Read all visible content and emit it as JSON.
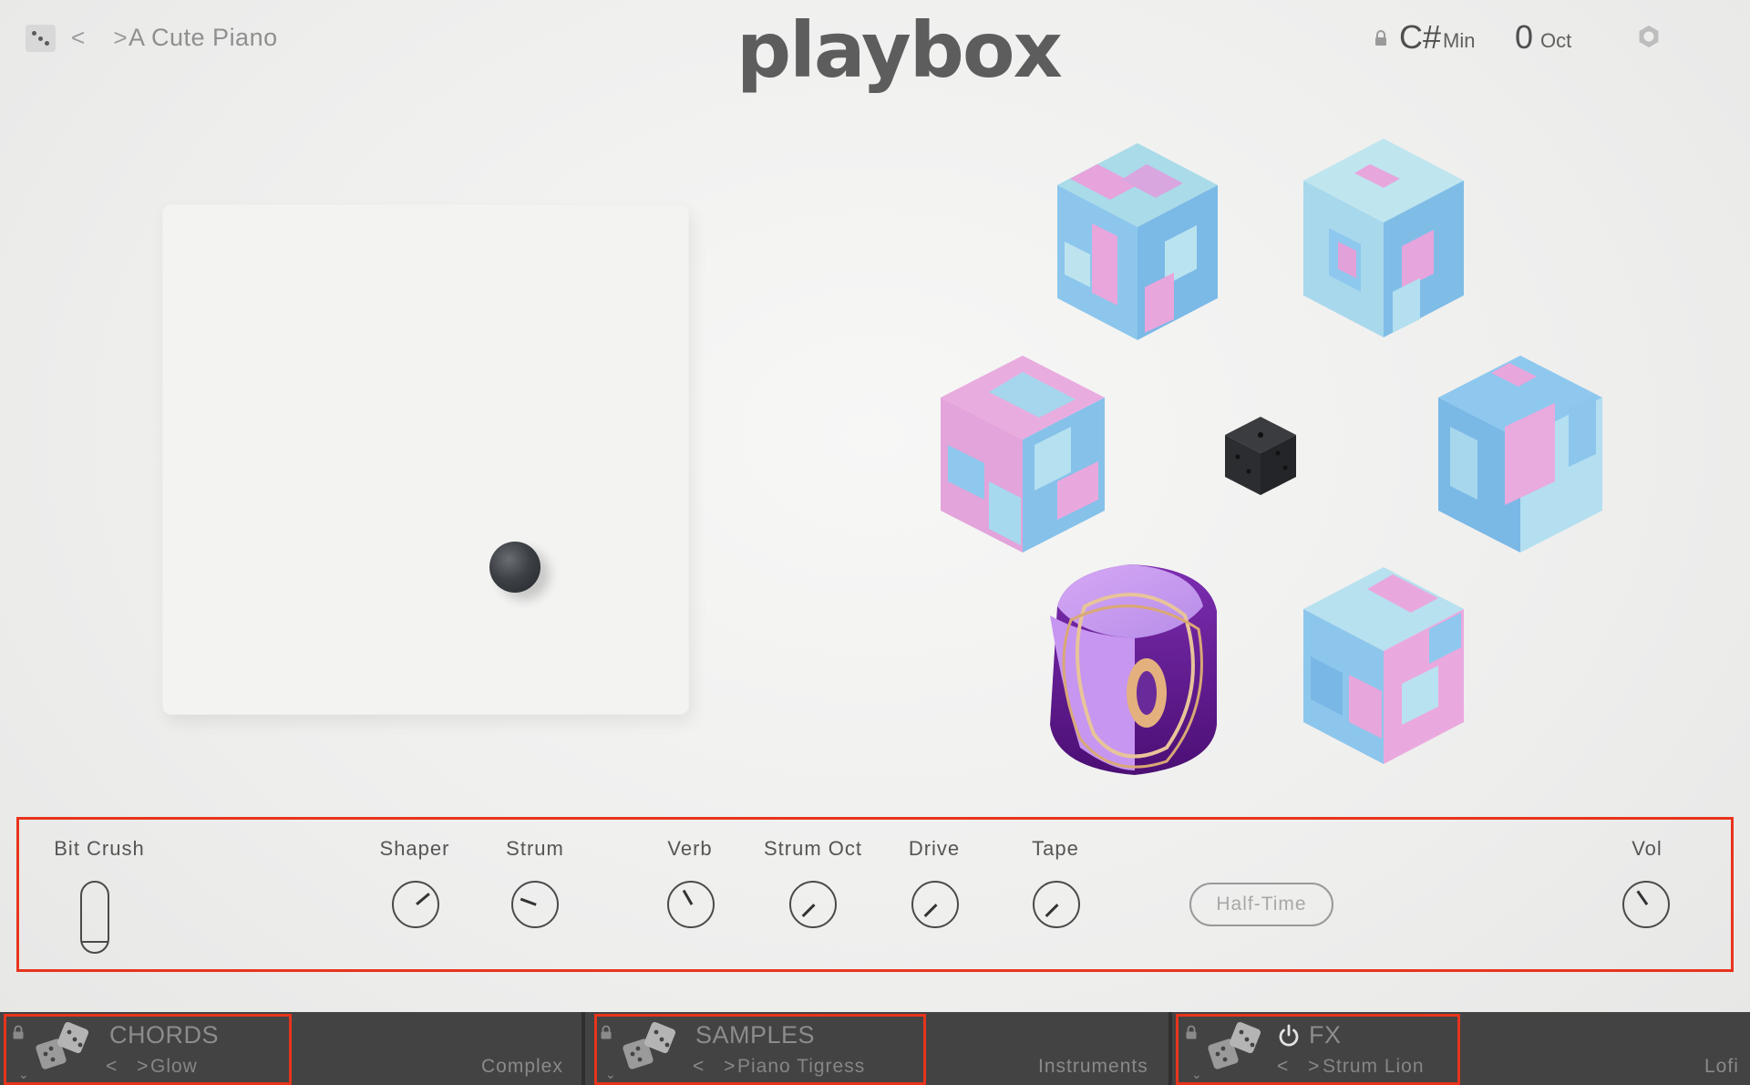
{
  "header": {
    "preset_name": "A Cute Piano",
    "nav_arrows": "< >",
    "logo": "playbox",
    "key": "C#",
    "mode": "Min",
    "octave_value": "0",
    "octave_label": "Oct"
  },
  "icons": {
    "menu": "dice-menu-icon",
    "lock": "lock-icon",
    "settings": "gear-icon",
    "center": "dice-icon",
    "power": "power-icon"
  },
  "controls": {
    "bit_crush": "Bit Crush",
    "shaper": "Shaper",
    "strum": "Strum",
    "verb": "Verb",
    "strum_oct": "Strum Oct",
    "drive": "Drive",
    "tape": "Tape",
    "half_time": "Half-Time",
    "vol": "Vol"
  },
  "tiles": {
    "chords": {
      "title": "CHORDS",
      "arrows": "< >",
      "value": "Glow",
      "category": "Complex"
    },
    "samples": {
      "title": "SAMPLES",
      "arrows": "< >",
      "value": "Piano Tigress",
      "category": "Instruments"
    },
    "fx": {
      "title": "FX",
      "arrows": "< >",
      "value": "Strum Lion",
      "category": "Lofi"
    }
  },
  "colors": {
    "highlight_border": "#e8341c",
    "cube_pink": "#e9a6df",
    "cube_blue": "#8ec8ee",
    "cube_light_blue": "#b8e2ee",
    "active_cube_purple": "#b57ee6",
    "bottom_bar": "#3e3e3e"
  }
}
